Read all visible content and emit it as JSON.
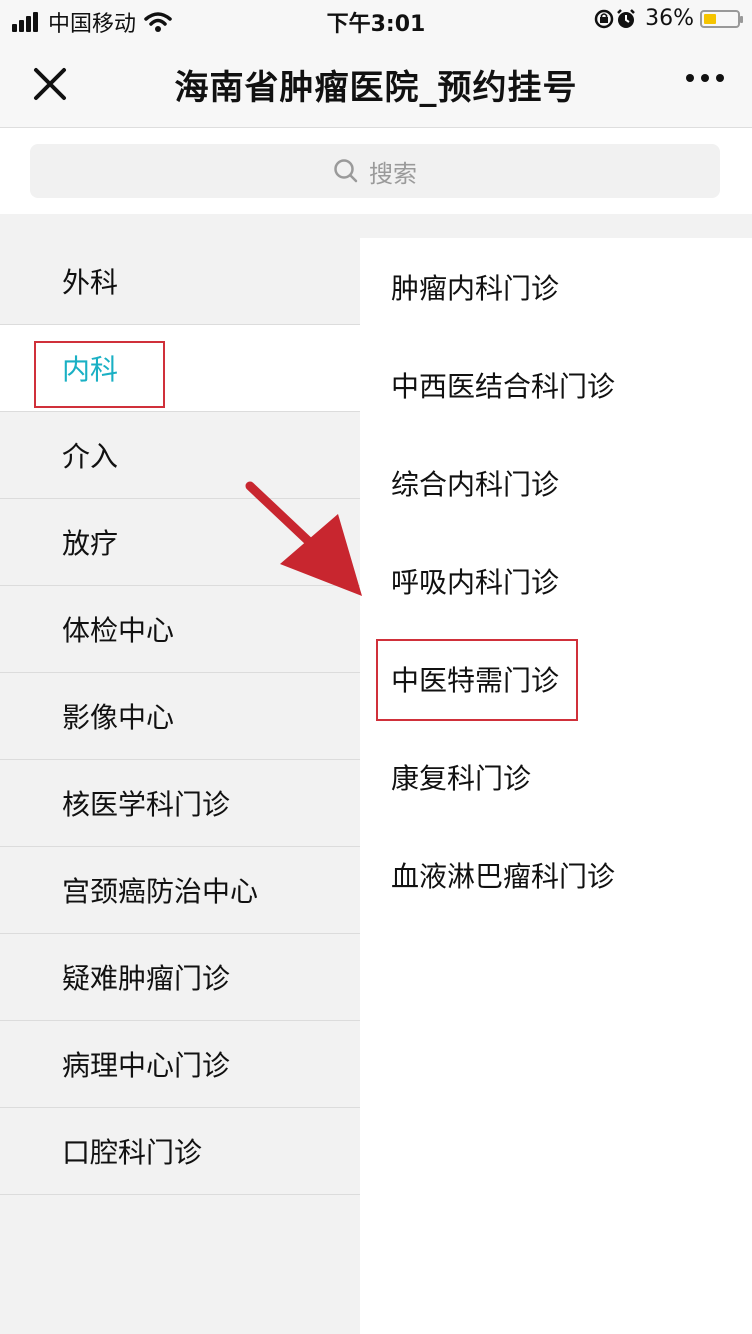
{
  "status_bar": {
    "carrier": "中国移动",
    "time": "下午3:01",
    "battery_percent": "36%",
    "battery_level": 0.36
  },
  "nav": {
    "title": "海南省肿瘤医院_预约挂号",
    "close_icon": "close-icon",
    "more_icon": "more-icon"
  },
  "search": {
    "placeholder": "搜索"
  },
  "left_menu": {
    "active_index": 1,
    "items": [
      {
        "label": "外科"
      },
      {
        "label": "内科"
      },
      {
        "label": "介入"
      },
      {
        "label": "放疗"
      },
      {
        "label": "体检中心"
      },
      {
        "label": "影像中心"
      },
      {
        "label": "核医学科门诊"
      },
      {
        "label": "宫颈癌防治中心"
      },
      {
        "label": "疑难肿瘤门诊"
      },
      {
        "label": "病理中心门诊"
      },
      {
        "label": "口腔科门诊"
      }
    ]
  },
  "right_list": {
    "items": [
      {
        "label": "肿瘤内科门诊"
      },
      {
        "label": "中西医结合科门诊"
      },
      {
        "label": "综合内科门诊"
      },
      {
        "label": "呼吸内科门诊"
      },
      {
        "label": "中医特需门诊"
      },
      {
        "label": "康复科门诊"
      },
      {
        "label": "血液淋巴瘤科门诊"
      }
    ]
  },
  "colors": {
    "accent": "#1ab0c4",
    "annotation_red": "#d0303a",
    "battery_yellow": "#f5c400"
  }
}
